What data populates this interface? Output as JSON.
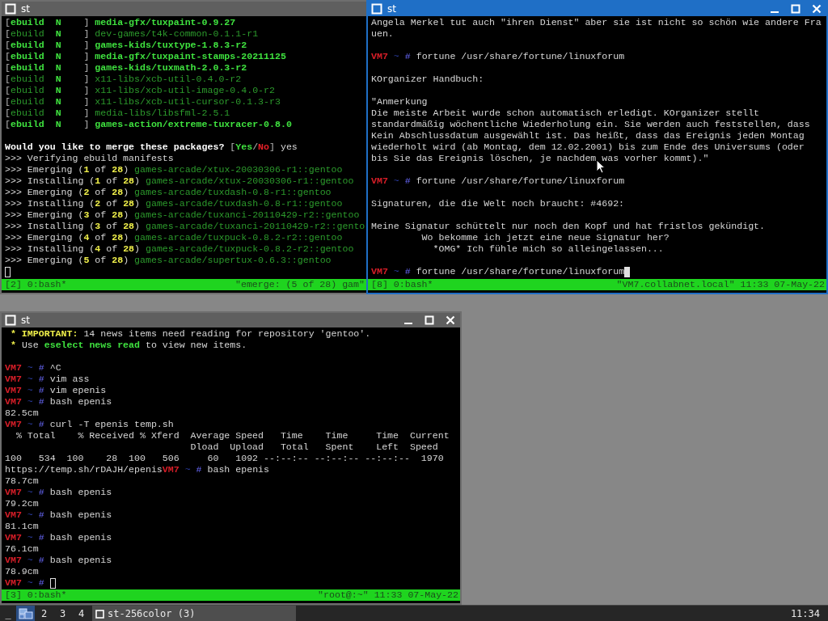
{
  "windows": [
    {
      "title": "st",
      "active": false,
      "lines": [
        {
          "kind": "text",
          "segments": [
            {
              "kind": "bracket",
              "text": "["
            },
            {
              "kind": "green",
              "text": "ebuild  N"
            },
            {
              "kind": "bracket",
              "text": "    ] "
            },
            {
              "kind": "green",
              "text": "media-gfx/tuxpaint-0.9.27"
            }
          ]
        },
        {
          "kind": "text",
          "segments": [
            {
              "kind": "bracket",
              "text": "["
            },
            {
              "kind": "dim",
              "text": "ebuild"
            },
            {
              "kind": "green",
              "text": "  N"
            },
            {
              "kind": "bracket",
              "text": "    ] "
            },
            {
              "kind": "dim",
              "text": "dev-games/t4k-common-0.1.1-r1"
            }
          ]
        },
        {
          "kind": "text",
          "segments": [
            {
              "kind": "bracket",
              "text": "["
            },
            {
              "kind": "green",
              "text": "ebuild  N"
            },
            {
              "kind": "bracket",
              "text": "    ] "
            },
            {
              "kind": "green",
              "text": "games-kids/tuxtype-1.8.3-r2"
            }
          ]
        },
        {
          "kind": "text",
          "segments": [
            {
              "kind": "bracket",
              "text": "["
            },
            {
              "kind": "green",
              "text": "ebuild  N"
            },
            {
              "kind": "bracket",
              "text": "    ] "
            },
            {
              "kind": "green",
              "text": "media-gfx/tuxpaint-stamps-20211125"
            }
          ]
        },
        {
          "kind": "text",
          "segments": [
            {
              "kind": "bracket",
              "text": "["
            },
            {
              "kind": "green",
              "text": "ebuild  N"
            },
            {
              "kind": "bracket",
              "text": "    ] "
            },
            {
              "kind": "green",
              "text": "games-kids/tuxmath-2.0.3-r2"
            }
          ]
        },
        {
          "kind": "text",
          "segments": [
            {
              "kind": "bracket",
              "text": "["
            },
            {
              "kind": "dim",
              "text": "ebuild"
            },
            {
              "kind": "green",
              "text": "  N"
            },
            {
              "kind": "bracket",
              "text": "    ] "
            },
            {
              "kind": "dim",
              "text": "x11-libs/xcb-util-0.4.0-r2"
            }
          ]
        },
        {
          "kind": "text",
          "segments": [
            {
              "kind": "bracket",
              "text": "["
            },
            {
              "kind": "dim",
              "text": "ebuild"
            },
            {
              "kind": "green",
              "text": "  N"
            },
            {
              "kind": "bracket",
              "text": "    ] "
            },
            {
              "kind": "dim",
              "text": "x11-libs/xcb-util-image-0.4.0-r2"
            }
          ]
        },
        {
          "kind": "text",
          "segments": [
            {
              "kind": "bracket",
              "text": "["
            },
            {
              "kind": "dim",
              "text": "ebuild"
            },
            {
              "kind": "green",
              "text": "  N"
            },
            {
              "kind": "bracket",
              "text": "    ] "
            },
            {
              "kind": "dim",
              "text": "x11-libs/xcb-util-cursor-0.1.3-r3"
            }
          ]
        },
        {
          "kind": "text",
          "segments": [
            {
              "kind": "bracket",
              "text": "["
            },
            {
              "kind": "dim",
              "text": "ebuild"
            },
            {
              "kind": "green",
              "text": "  N"
            },
            {
              "kind": "bracket",
              "text": "    ] "
            },
            {
              "kind": "dim",
              "text": "media-libs/libsfml-2.5.1"
            }
          ]
        },
        {
          "kind": "text",
          "segments": [
            {
              "kind": "bracket",
              "text": "["
            },
            {
              "kind": "green",
              "text": "ebuild  N"
            },
            {
              "kind": "bracket",
              "text": "    ] "
            },
            {
              "kind": "green",
              "text": "games-action/extreme-tuxracer-0.8.0"
            }
          ]
        },
        {
          "kind": "blank"
        },
        {
          "kind": "text",
          "segments": [
            {
              "kind": "bold",
              "text": "Would you like to merge these packages? "
            },
            {
              "kind": "bracket",
              "text": "["
            },
            {
              "kind": "green",
              "text": "Yes"
            },
            {
              "kind": "bracket",
              "text": "/"
            },
            {
              "kind": "red",
              "text": "No"
            },
            {
              "kind": "bracket",
              "text": "]"
            },
            {
              "kind": "plain",
              "text": " yes"
            }
          ]
        },
        {
          "kind": "text",
          "segments": [
            {
              "kind": "plain",
              "text": ">>> Verifying ebuild manifests"
            }
          ]
        },
        {
          "kind": "text",
          "segments": [
            {
              "kind": "plain",
              "text": ">>> Emerging ("
            },
            {
              "kind": "yellow",
              "text": "1"
            },
            {
              "kind": "plain",
              "text": " of "
            },
            {
              "kind": "yellow",
              "text": "28"
            },
            {
              "kind": "plain",
              "text": ") "
            },
            {
              "kind": "dim",
              "text": "games-arcade/xtux-20030306-r1::gentoo"
            }
          ]
        },
        {
          "kind": "text",
          "segments": [
            {
              "kind": "plain",
              "text": ">>> Installing ("
            },
            {
              "kind": "yellow",
              "text": "1"
            },
            {
              "kind": "plain",
              "text": " of "
            },
            {
              "kind": "yellow",
              "text": "28"
            },
            {
              "kind": "plain",
              "text": ") "
            },
            {
              "kind": "dim",
              "text": "games-arcade/xtux-20030306-r1::gentoo"
            }
          ]
        },
        {
          "kind": "text",
          "segments": [
            {
              "kind": "plain",
              "text": ">>> Emerging ("
            },
            {
              "kind": "yellow",
              "text": "2"
            },
            {
              "kind": "plain",
              "text": " of "
            },
            {
              "kind": "yellow",
              "text": "28"
            },
            {
              "kind": "plain",
              "text": ") "
            },
            {
              "kind": "dim",
              "text": "games-arcade/tuxdash-0.8-r1::gentoo"
            }
          ]
        },
        {
          "kind": "text",
          "segments": [
            {
              "kind": "plain",
              "text": ">>> Installing ("
            },
            {
              "kind": "yellow",
              "text": "2"
            },
            {
              "kind": "plain",
              "text": " of "
            },
            {
              "kind": "yellow",
              "text": "28"
            },
            {
              "kind": "plain",
              "text": ") "
            },
            {
              "kind": "dim",
              "text": "games-arcade/tuxdash-0.8-r1::gentoo"
            }
          ]
        },
        {
          "kind": "text",
          "segments": [
            {
              "kind": "plain",
              "text": ">>> Emerging ("
            },
            {
              "kind": "yellow",
              "text": "3"
            },
            {
              "kind": "plain",
              "text": " of "
            },
            {
              "kind": "yellow",
              "text": "28"
            },
            {
              "kind": "plain",
              "text": ") "
            },
            {
              "kind": "dim",
              "text": "games-arcade/tuxanci-20110429-r2::gentoo"
            }
          ]
        },
        {
          "kind": "text",
          "segments": [
            {
              "kind": "plain",
              "text": ">>> Installing ("
            },
            {
              "kind": "yellow",
              "text": "3"
            },
            {
              "kind": "plain",
              "text": " of "
            },
            {
              "kind": "yellow",
              "text": "28"
            },
            {
              "kind": "plain",
              "text": ") "
            },
            {
              "kind": "dim",
              "text": "games-arcade/tuxanci-20110429-r2::gento"
            }
          ]
        },
        {
          "kind": "text",
          "segments": [
            {
              "kind": "plain",
              "text": ">>> Emerging ("
            },
            {
              "kind": "yellow",
              "text": "4"
            },
            {
              "kind": "plain",
              "text": " of "
            },
            {
              "kind": "yellow",
              "text": "28"
            },
            {
              "kind": "plain",
              "text": ") "
            },
            {
              "kind": "dim",
              "text": "games-arcade/tuxpuck-0.8.2-r2::gentoo"
            }
          ]
        },
        {
          "kind": "text",
          "segments": [
            {
              "kind": "plain",
              "text": ">>> Installing ("
            },
            {
              "kind": "yellow",
              "text": "4"
            },
            {
              "kind": "plain",
              "text": " of "
            },
            {
              "kind": "yellow",
              "text": "28"
            },
            {
              "kind": "plain",
              "text": ") "
            },
            {
              "kind": "dim",
              "text": "games-arcade/tuxpuck-0.8.2-r2::gentoo"
            }
          ]
        },
        {
          "kind": "text",
          "segments": [
            {
              "kind": "plain",
              "text": ">>> Emerging ("
            },
            {
              "kind": "yellow",
              "text": "5"
            },
            {
              "kind": "plain",
              "text": " of "
            },
            {
              "kind": "yellow",
              "text": "28"
            },
            {
              "kind": "plain",
              "text": ") "
            },
            {
              "kind": "dim",
              "text": "games-arcade/supertux-0.6.3::gentoo"
            }
          ]
        },
        {
          "kind": "cursor",
          "cursor": true
        }
      ],
      "status": {
        "left": "[2] 0:bash*",
        "right": "\"emerge: (5 of 28) gam\""
      }
    },
    {
      "title": "st",
      "active": true,
      "controls": [
        {
          "kind": "minimize"
        },
        {
          "kind": "maximize"
        },
        {
          "kind": "close"
        }
      ],
      "lines": [
        {
          "kind": "text",
          "segments": [
            {
              "kind": "plain",
              "text": "Angela Merkel tut auch \"ihren Dienst\" aber sie ist nicht so schön wie andere Fra"
            }
          ]
        },
        {
          "kind": "text",
          "segments": [
            {
              "kind": "plain",
              "text": "uen."
            }
          ]
        },
        {
          "kind": "blank"
        },
        {
          "kind": "text",
          "segments": [
            {
              "kind": "host",
              "text": "VM7"
            },
            {
              "kind": "dir",
              "text": " ~ "
            },
            {
              "kind": "sign",
              "text": "#"
            },
            {
              "kind": "plain",
              "text": " fortune /usr/share/fortune/linuxforum"
            }
          ]
        },
        {
          "kind": "blank"
        },
        {
          "kind": "text",
          "segments": [
            {
              "kind": "plain",
              "text": "KOrganizer Handbuch:"
            }
          ]
        },
        {
          "kind": "blank"
        },
        {
          "kind": "text",
          "segments": [
            {
              "kind": "plain",
              "text": "\"Anmerkung"
            }
          ]
        },
        {
          "kind": "text",
          "segments": [
            {
              "kind": "plain",
              "text": "Die meiste Arbeit wurde schon automatisch erledigt. KOrganizer stellt"
            }
          ]
        },
        {
          "kind": "text",
          "segments": [
            {
              "kind": "plain",
              "text": "standardmäßig wöchentliche Wiederholung ein. Sie werden auch feststellen, dass"
            }
          ]
        },
        {
          "kind": "text",
          "segments": [
            {
              "kind": "plain",
              "text": "Kein Abschlussdatum ausgewählt ist. Das heißt, dass das Ereignis jeden Montag"
            }
          ]
        },
        {
          "kind": "text",
          "segments": [
            {
              "kind": "plain",
              "text": "wiederholt wird (ab Montag, dem 12.02.2001) bis zum Ende des Universums (oder"
            }
          ]
        },
        {
          "kind": "text",
          "segments": [
            {
              "kind": "plain",
              "text": "bis Sie das Ereignis löschen, je nachdem was vorher kommt).\""
            }
          ]
        },
        {
          "kind": "blank"
        },
        {
          "kind": "text",
          "segments": [
            {
              "kind": "host",
              "text": "VM7"
            },
            {
              "kind": "dir",
              "text": " ~ "
            },
            {
              "kind": "sign",
              "text": "#"
            },
            {
              "kind": "plain",
              "text": " fortune /usr/share/fortune/linuxforum"
            }
          ]
        },
        {
          "kind": "blank"
        },
        {
          "kind": "text",
          "segments": [
            {
              "kind": "plain",
              "text": "Signaturen, die die Welt noch braucht: #4692:"
            }
          ]
        },
        {
          "kind": "blank"
        },
        {
          "kind": "text",
          "segments": [
            {
              "kind": "plain",
              "text": "Meine Signatur schüttelt nur noch den Kopf und hat fristlos gekündigt."
            }
          ]
        },
        {
          "kind": "text",
          "segments": [
            {
              "kind": "plain",
              "text": "         Wo bekomme ich jetzt eine neue Signatur her?"
            }
          ]
        },
        {
          "kind": "text",
          "segments": [
            {
              "kind": "plain",
              "text": "           *OMG* Ich fühle mich so alleingelassen..."
            }
          ]
        },
        {
          "kind": "blank"
        },
        {
          "kind": "text",
          "cursor": true,
          "segments": [
            {
              "kind": "host",
              "text": "VM7"
            },
            {
              "kind": "dir",
              "text": " ~ "
            },
            {
              "kind": "sign",
              "text": "#"
            },
            {
              "kind": "plain",
              "text": " fortune /usr/share/fortune/linuxforum"
            }
          ]
        }
      ],
      "status": {
        "left": "[8] 0:bash*",
        "right": "\"VM7.collabnet.local\" 11:33 07-May-22"
      }
    },
    {
      "title": "st",
      "active": false,
      "controls": [
        {
          "kind": "minimize"
        },
        {
          "kind": "maximize"
        },
        {
          "kind": "close"
        }
      ],
      "lines": [
        {
          "kind": "text",
          "segments": [
            {
              "kind": "yellow",
              "text": " * IMPORTANT:"
            },
            {
              "kind": "plain",
              "text": " 14 news items need reading for repository 'gentoo'."
            }
          ]
        },
        {
          "kind": "text",
          "segments": [
            {
              "kind": "yellow",
              "text": " *"
            },
            {
              "kind": "plain",
              "text": " Use "
            },
            {
              "kind": "green",
              "text": "eselect news read"
            },
            {
              "kind": "plain",
              "text": " to view new items."
            }
          ]
        },
        {
          "kind": "blank"
        },
        {
          "kind": "text",
          "segments": [
            {
              "kind": "host",
              "text": "VM7"
            },
            {
              "kind": "dir",
              "text": " ~ "
            },
            {
              "kind": "sign",
              "text": "#"
            },
            {
              "kind": "plain",
              "text": " ^C"
            }
          ]
        },
        {
          "kind": "text",
          "segments": [
            {
              "kind": "host",
              "text": "VM7"
            },
            {
              "kind": "dir",
              "text": " ~ "
            },
            {
              "kind": "sign",
              "text": "#"
            },
            {
              "kind": "plain",
              "text": " vim ass"
            }
          ]
        },
        {
          "kind": "text",
          "segments": [
            {
              "kind": "host",
              "text": "VM7"
            },
            {
              "kind": "dir",
              "text": " ~ "
            },
            {
              "kind": "sign",
              "text": "#"
            },
            {
              "kind": "plain",
              "text": " vim epenis"
            }
          ]
        },
        {
          "kind": "text",
          "segments": [
            {
              "kind": "host",
              "text": "VM7"
            },
            {
              "kind": "dir",
              "text": " ~ "
            },
            {
              "kind": "sign",
              "text": "#"
            },
            {
              "kind": "plain",
              "text": " bash epenis"
            }
          ]
        },
        {
          "kind": "text",
          "segments": [
            {
              "kind": "plain",
              "text": "82.5cm"
            }
          ]
        },
        {
          "kind": "text",
          "segments": [
            {
              "kind": "host",
              "text": "VM7"
            },
            {
              "kind": "dir",
              "text": " ~ "
            },
            {
              "kind": "sign",
              "text": "#"
            },
            {
              "kind": "plain",
              "text": " curl -T epenis temp.sh"
            }
          ]
        },
        {
          "kind": "text",
          "segments": [
            {
              "kind": "plain",
              "text": "  % Total    % Received % Xferd  Average Speed   Time    Time     Time  Current"
            }
          ]
        },
        {
          "kind": "text",
          "segments": [
            {
              "kind": "plain",
              "text": "                                 Dload  Upload   Total   Spent    Left  Speed"
            }
          ]
        },
        {
          "kind": "text",
          "segments": [
            {
              "kind": "plain",
              "text": "100   534  100    28  100   506     60   1092 --:--:-- --:--:-- --:--:--  1970"
            }
          ]
        },
        {
          "kind": "text",
          "segments": [
            {
              "kind": "plain",
              "text": "https://temp.sh/rDAJH/epenis"
            },
            {
              "kind": "host",
              "text": "VM7"
            },
            {
              "kind": "dir",
              "text": " ~ "
            },
            {
              "kind": "sign",
              "text": "#"
            },
            {
              "kind": "plain",
              "text": " bash epenis"
            }
          ]
        },
        {
          "kind": "text",
          "segments": [
            {
              "kind": "plain",
              "text": "78.7cm"
            }
          ]
        },
        {
          "kind": "text",
          "segments": [
            {
              "kind": "host",
              "text": "VM7"
            },
            {
              "kind": "dir",
              "text": " ~ "
            },
            {
              "kind": "sign",
              "text": "#"
            },
            {
              "kind": "plain",
              "text": " bash epenis"
            }
          ]
        },
        {
          "kind": "text",
          "segments": [
            {
              "kind": "plain",
              "text": "79.2cm"
            }
          ]
        },
        {
          "kind": "text",
          "segments": [
            {
              "kind": "host",
              "text": "VM7"
            },
            {
              "kind": "dir",
              "text": " ~ "
            },
            {
              "kind": "sign",
              "text": "#"
            },
            {
              "kind": "plain",
              "text": " bash epenis"
            }
          ]
        },
        {
          "kind": "text",
          "segments": [
            {
              "kind": "plain",
              "text": "81.1cm"
            }
          ]
        },
        {
          "kind": "text",
          "segments": [
            {
              "kind": "host",
              "text": "VM7"
            },
            {
              "kind": "dir",
              "text": " ~ "
            },
            {
              "kind": "sign",
              "text": "#"
            },
            {
              "kind": "plain",
              "text": " bash epenis"
            }
          ]
        },
        {
          "kind": "text",
          "segments": [
            {
              "kind": "plain",
              "text": "76.1cm"
            }
          ]
        },
        {
          "kind": "text",
          "segments": [
            {
              "kind": "host",
              "text": "VM7"
            },
            {
              "kind": "dir",
              "text": " ~ "
            },
            {
              "kind": "sign",
              "text": "#"
            },
            {
              "kind": "plain",
              "text": " bash epenis"
            }
          ]
        },
        {
          "kind": "text",
          "segments": [
            {
              "kind": "plain",
              "text": "78.9cm"
            }
          ]
        },
        {
          "kind": "text",
          "cursor": true,
          "segments": [
            {
              "kind": "host",
              "text": "VM7"
            },
            {
              "kind": "dir",
              "text": " ~ "
            },
            {
              "kind": "sign",
              "text": "# "
            }
          ]
        }
      ],
      "status": {
        "left": "[3] 0:bash*",
        "right": "\"root@:~\" 11:33 07-May-22"
      }
    }
  ],
  "taskbar": {
    "menu": "_",
    "desktops": [
      {
        "selected": true
      },
      {
        "label": "2",
        "selected": false
      },
      {
        "label": "3",
        "selected": false
      },
      {
        "label": "4",
        "selected": false
      }
    ],
    "tasks": [
      {
        "label": "st-256color (3)"
      }
    ],
    "clock": "11:34"
  }
}
